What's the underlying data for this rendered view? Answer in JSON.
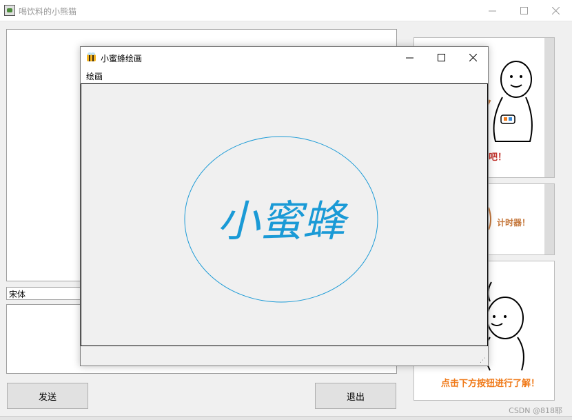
{
  "main_window": {
    "title": "喝饮料的小熊猫",
    "font_select_value": "宋体",
    "send_label": "发送",
    "exit_label": "退出"
  },
  "child_window": {
    "title": "小蜜蜂绘画",
    "menu": [
      "绘画"
    ],
    "canvas_text": "小蜜蜂",
    "ellipse_color": "#1a9ad6"
  },
  "right_panels": [
    {
      "text": "吧！"
    },
    {
      "text": "计时器！"
    },
    {
      "text": "点击下方按钮进行了解！"
    }
  ],
  "watermark": "CSDN @818耶",
  "colors": {
    "accent_red": "#c0302a",
    "accent_orange": "#f07b1b",
    "accent_brown": "#c4763a"
  }
}
